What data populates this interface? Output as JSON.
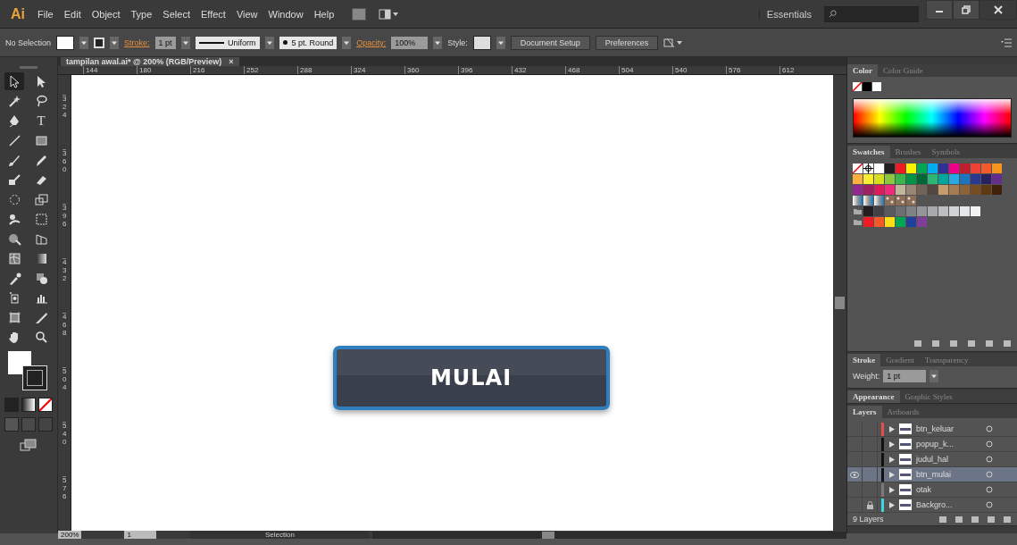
{
  "menubar": {
    "logo": "Ai",
    "items": [
      "File",
      "Edit",
      "Object",
      "Type",
      "Select",
      "Effect",
      "View",
      "Window",
      "Help"
    ],
    "workspace": "Essentials"
  },
  "control_bar": {
    "selection": "No Selection",
    "stroke_label": "Stroke:",
    "stroke_weight": "1 pt",
    "stroke_profile": "Uniform",
    "brush": "5 pt. Round",
    "opacity_label": "Opacity:",
    "opacity": "100%",
    "style_label": "Style:",
    "buttons": [
      "Document Setup",
      "Preferences"
    ]
  },
  "document_tab": {
    "title": "tampilan awal.ai* @ 200% (RGB/Preview)",
    "close": "×"
  },
  "ruler": {
    "horizontal": [
      "144",
      "180",
      "216",
      "252",
      "288",
      "324",
      "360",
      "396",
      "432",
      "468",
      "504",
      "540",
      "576",
      "612"
    ],
    "vertical": [
      "324",
      "360",
      "396",
      "432",
      "468",
      "504",
      "540",
      "576"
    ]
  },
  "tools": [
    {
      "kind": "selection",
      "selected": true
    },
    {
      "kind": "direct-selection",
      "selected": false
    },
    {
      "kind": "magic-wand",
      "selected": false
    },
    {
      "kind": "lasso",
      "selected": false
    },
    {
      "kind": "pen",
      "selected": false
    },
    {
      "kind": "type",
      "selected": false,
      "glyph": "T"
    },
    {
      "kind": "line",
      "selected": false
    },
    {
      "kind": "rectangle",
      "selected": false
    },
    {
      "kind": "paintbrush",
      "selected": false
    },
    {
      "kind": "pencil",
      "selected": false
    },
    {
      "kind": "blob-brush",
      "selected": false
    },
    {
      "kind": "eraser",
      "selected": false
    },
    {
      "kind": "rotate",
      "selected": false
    },
    {
      "kind": "scale",
      "selected": false
    },
    {
      "kind": "warp",
      "selected": false
    },
    {
      "kind": "free-transform",
      "selected": false
    },
    {
      "kind": "shape-builder",
      "selected": false
    },
    {
      "kind": "perspective-grid",
      "selected": false
    },
    {
      "kind": "mesh",
      "selected": false
    },
    {
      "kind": "gradient",
      "selected": false
    },
    {
      "kind": "eyedropper",
      "selected": false
    },
    {
      "kind": "blend",
      "selected": false
    },
    {
      "kind": "symbol-sprayer",
      "selected": false
    },
    {
      "kind": "column-graph",
      "selected": false
    },
    {
      "kind": "artboard",
      "selected": false
    },
    {
      "kind": "slice",
      "selected": false
    },
    {
      "kind": "hand",
      "selected": false
    },
    {
      "kind": "zoom",
      "selected": false
    }
  ],
  "canvas": {
    "button_label": "MULAI"
  },
  "color_panel": {
    "tabs": [
      {
        "label": "Color",
        "selected": true
      },
      {
        "label": "Color Guide",
        "selected": false
      }
    ]
  },
  "swatches_panel": {
    "tabs": [
      {
        "label": "Swatches",
        "selected": true
      },
      {
        "label": "Brushes",
        "selected": false
      },
      {
        "label": "Symbols",
        "selected": false
      }
    ],
    "rows": [
      [
        {
          "kind": "none"
        },
        {
          "kind": "registration"
        },
        {
          "kind": "color",
          "color": "#ffffff"
        },
        {
          "kind": "color",
          "color": "#231f20"
        },
        {
          "kind": "color",
          "color": "#ed1c24"
        },
        {
          "kind": "color",
          "color": "#fff200"
        },
        {
          "kind": "color",
          "color": "#00a651"
        },
        {
          "kind": "color",
          "color": "#00aeef"
        },
        {
          "kind": "color",
          "color": "#2e3192"
        },
        {
          "kind": "color",
          "color": "#ec008c"
        },
        {
          "kind": "color",
          "color": "#be1e2d"
        },
        {
          "kind": "color",
          "color": "#ef4136"
        },
        {
          "kind": "color",
          "color": "#f15a29"
        },
        {
          "kind": "color",
          "color": "#f7941d"
        }
      ],
      [
        {
          "kind": "color",
          "color": "#fbb040"
        },
        {
          "kind": "color",
          "color": "#f9ed32"
        },
        {
          "kind": "color",
          "color": "#d7df23"
        },
        {
          "kind": "color",
          "color": "#8dc63f"
        },
        {
          "kind": "color",
          "color": "#39b54a"
        },
        {
          "kind": "color",
          "color": "#009444"
        },
        {
          "kind": "color",
          "color": "#006838"
        },
        {
          "kind": "color",
          "color": "#2bb673"
        },
        {
          "kind": "color",
          "color": "#00a79d"
        },
        {
          "kind": "color",
          "color": "#27aae1"
        },
        {
          "kind": "color",
          "color": "#1c75bc"
        },
        {
          "kind": "color",
          "color": "#2b3990"
        },
        {
          "kind": "color",
          "color": "#262262"
        },
        {
          "kind": "color",
          "color": "#662d91"
        }
      ],
      [
        {
          "kind": "color",
          "color": "#92278f"
        },
        {
          "kind": "color",
          "color": "#9e1f63"
        },
        {
          "kind": "color",
          "color": "#da1c5c"
        },
        {
          "kind": "color",
          "color": "#ee2a7b"
        },
        {
          "kind": "color",
          "color": "#c2b59b"
        },
        {
          "kind": "color",
          "color": "#998675"
        },
        {
          "kind": "color",
          "color": "#736357"
        },
        {
          "kind": "color",
          "color": "#534741"
        },
        {
          "kind": "color",
          "color": "#c69c6d"
        },
        {
          "kind": "color",
          "color": "#a67c52"
        },
        {
          "kind": "color",
          "color": "#8c6239"
        },
        {
          "kind": "color",
          "color": "#754c24"
        },
        {
          "kind": "color",
          "color": "#603913"
        },
        {
          "kind": "color",
          "color": "#42210b"
        }
      ],
      [
        {
          "kind": "gradient"
        },
        {
          "kind": "gradient"
        },
        {
          "kind": "gradient"
        },
        {
          "kind": "pattern"
        },
        {
          "kind": "pattern"
        },
        {
          "kind": "pattern"
        }
      ],
      [
        {
          "kind": "folder"
        },
        {
          "kind": "color",
          "color": "#231f20"
        },
        {
          "kind": "color",
          "color": "#414042"
        },
        {
          "kind": "color",
          "color": "#58595b"
        },
        {
          "kind": "color",
          "color": "#6d6e71"
        },
        {
          "kind": "color",
          "color": "#808285"
        },
        {
          "kind": "color",
          "color": "#939598"
        },
        {
          "kind": "color",
          "color": "#a7a9ac"
        },
        {
          "kind": "color",
          "color": "#bcbec0"
        },
        {
          "kind": "color",
          "color": "#d1d3d4"
        },
        {
          "kind": "color",
          "color": "#e6e7e8"
        },
        {
          "kind": "color",
          "color": "#f1f2f2"
        }
      ],
      [
        {
          "kind": "folder"
        },
        {
          "kind": "color",
          "color": "#ed1c24"
        },
        {
          "kind": "color",
          "color": "#f15a29"
        },
        {
          "kind": "color",
          "color": "#ffde17"
        },
        {
          "kind": "color",
          "color": "#00a651"
        },
        {
          "kind": "color",
          "color": "#21409a"
        },
        {
          "kind": "color",
          "color": "#7f3f98"
        }
      ]
    ]
  },
  "stroke_panel": {
    "tabs": [
      {
        "label": "Stroke",
        "selected": true
      },
      {
        "label": "Gradient",
        "selected": false
      },
      {
        "label": "Transparency",
        "selected": false
      }
    ],
    "weight_label": "Weight:",
    "weight": "1 pt"
  },
  "appearance_panel": {
    "tabs": [
      {
        "label": "Appearance",
        "selected": true
      },
      {
        "label": "Graphic Styles",
        "selected": false
      }
    ]
  },
  "layers_panel": {
    "tabs": [
      {
        "label": "Layers",
        "selected": true
      },
      {
        "label": "Artboards",
        "selected": false
      }
    ],
    "layers": [
      {
        "name": "btn_keluar",
        "color": "#e84c4c",
        "visible": false,
        "locked": false,
        "selected": false
      },
      {
        "name": "popup_k...",
        "color": "#111111",
        "visible": false,
        "locked": false,
        "selected": false
      },
      {
        "name": "judul_hal",
        "color": "#111111",
        "visible": false,
        "locked": false,
        "selected": false
      },
      {
        "name": "btn_mulai",
        "color": "#111111",
        "visible": true,
        "locked": false,
        "selected": true
      },
      {
        "name": "otak",
        "color": "#7a7a7a",
        "visible": false,
        "locked": false,
        "selected": false
      },
      {
        "name": "Backgro...",
        "color": "#3ed6e0",
        "visible": false,
        "locked": true,
        "selected": false
      }
    ],
    "count": "9 Layers"
  },
  "status_bar": {
    "zoom": "200%",
    "artboard": "1",
    "tool": "Selection"
  }
}
